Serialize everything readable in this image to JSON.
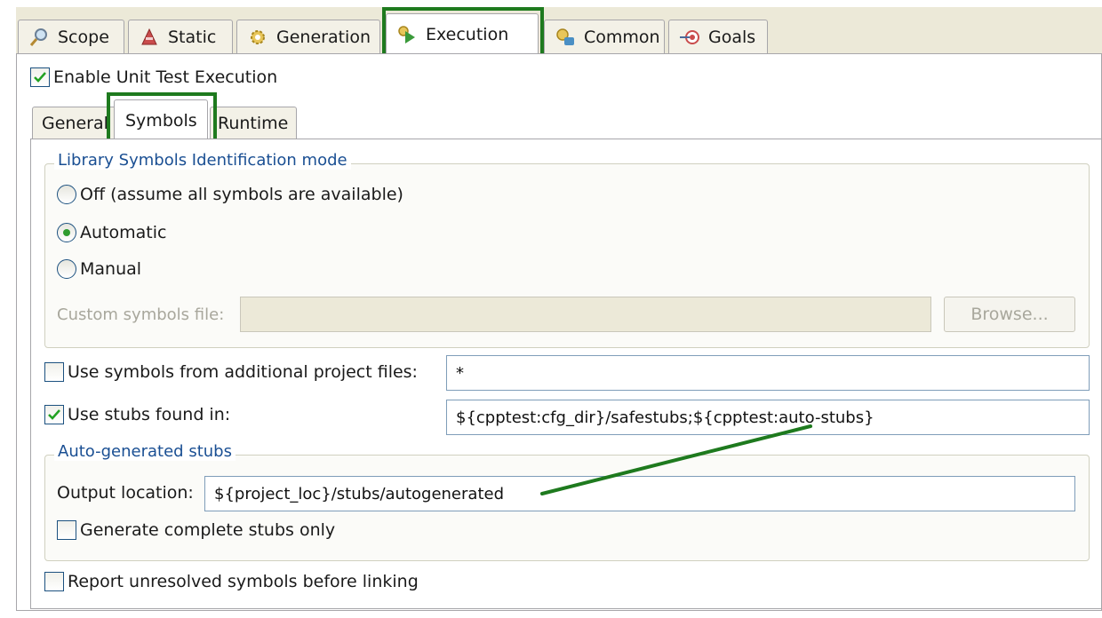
{
  "top_tabs": [
    {
      "label": "Scope",
      "icon": "magnifier-icon"
    },
    {
      "label": "Static",
      "icon": "static-analysis-icon"
    },
    {
      "label": "Generation",
      "icon": "generation-gear-icon"
    },
    {
      "label": "Execution",
      "icon": "execution-play-icon",
      "active": true
    },
    {
      "label": "Common",
      "icon": "common-icon"
    },
    {
      "label": "Goals",
      "icon": "goals-target-icon"
    }
  ],
  "enable_unit_test_execution": {
    "label": "Enable Unit Test Execution",
    "checked": true
  },
  "inner_tabs": [
    {
      "label": "General"
    },
    {
      "label": "Symbols",
      "active": true
    },
    {
      "label": "Runtime"
    }
  ],
  "library_group": {
    "title": "Library Symbols Identification mode",
    "options": [
      {
        "label": "Off (assume all symbols are available)",
        "selected": false
      },
      {
        "label": "Automatic",
        "selected": true
      },
      {
        "label": "Manual",
        "selected": false
      }
    ],
    "custom_file_label": "Custom symbols file:",
    "custom_file_value": "",
    "browse_label": "Browse..."
  },
  "additional_project_files": {
    "label": "Use symbols from additional project files:",
    "checked": false,
    "value": "*"
  },
  "stubs_found_in": {
    "label": "Use stubs found in:",
    "checked": true,
    "value": "${cpptest:cfg_dir}/safestubs;${cpptest:auto-stubs}"
  },
  "auto_stubs_group": {
    "title": "Auto-generated stubs",
    "output_location_label": "Output location:",
    "output_location_value": "${project_loc}/stubs/autogenerated",
    "complete_stubs": {
      "label": "Generate complete stubs only",
      "checked": false
    }
  },
  "report_unresolved": {
    "label": "Report unresolved symbols before linking",
    "checked": false
  },
  "colors": {
    "highlight": "#1e7a1e",
    "group_title": "#1a4f93",
    "tab_bg": "#ece9d8"
  }
}
